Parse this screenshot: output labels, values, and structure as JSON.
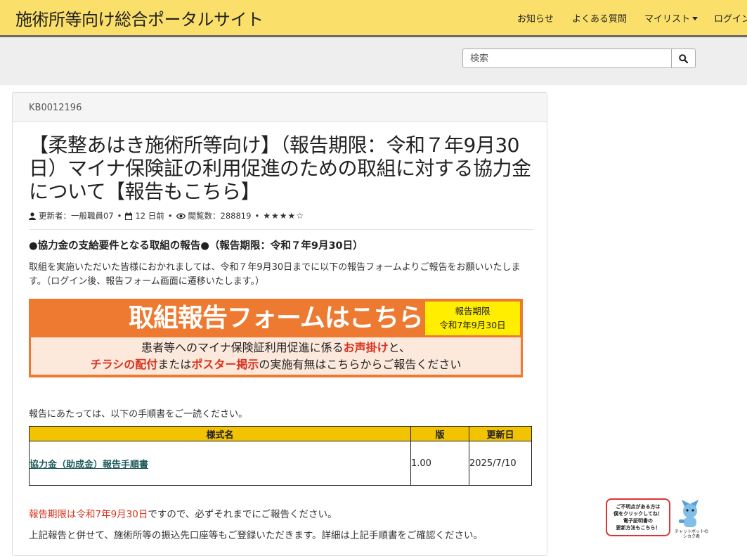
{
  "header": {
    "brand": "施術所等向け総合ポータルサイト",
    "nav": [
      "お知らせ",
      "よくある質問",
      "マイリスト",
      "ログイン"
    ]
  },
  "search": {
    "placeholder": "検索"
  },
  "article": {
    "kb_id": "KB0012196",
    "title": "【柔整あはき施術所等向け】（報告期限：令和７年9月30日）マイナ保険証の利用促進のための取組に対する協力金について【報告もこちら】",
    "meta": {
      "author": "更新者：一般職員07",
      "updated": "12 日前",
      "views": "閲覧数：288819",
      "rating": "★★★★☆"
    },
    "section_heading": "●協力金の支給要件となる取組の報告●（報告期限：令和７年9月30日）",
    "intro": "取組を実施いただいた皆様におかれましては、令和７年9月30日までに以下の報告フォームよりご報告をお願いいたします。（ログイン後、報告フォーム画面に遷移いたします。）",
    "banner": {
      "title": "取組報告フォームはこちら",
      "deadline_label": "報告期限",
      "deadline_date": "令和7年9月30日",
      "line1_a": "患者等へのマイナ保険証利用促進に係る",
      "line1_red": "お声掛け",
      "line1_b": "と、",
      "line2_red1": "チラシの配付",
      "line2_a": "または",
      "line2_red2": "ポスター掲示",
      "line2_b": "の実施有無はこちらからご報告ください"
    },
    "intro2": "報告にあたっては、以下の手順書をご一読ください。",
    "table": {
      "headers": [
        "様式名",
        "版",
        "更新日"
      ],
      "rows": [
        {
          "name": "協力金（助成金）報告手順書",
          "version": "1.00",
          "date": "2025/7/10"
        }
      ]
    },
    "note_red": "報告期限は令和7年9月30日",
    "note_rest": "ですので、必ずそれまでにご報告ください。",
    "note2": "上記報告と併せて、施術所等の振込先口座等もご登録いただきます。詳細は上記手順書をご確認ください。"
  },
  "chatbot": {
    "bubble_lines": [
      "ご不明点がある方は",
      "僕をクリックしてね！",
      "電子証明書の",
      "更新方法もこちら！"
    ],
    "label_1": "チャットボットの",
    "label_2": "シカク君"
  },
  "colors": {
    "header_bg": "#fadf6a",
    "banner_orange": "#ee7a31",
    "table_header": "#f2c300",
    "accent_red": "#d9331f"
  }
}
